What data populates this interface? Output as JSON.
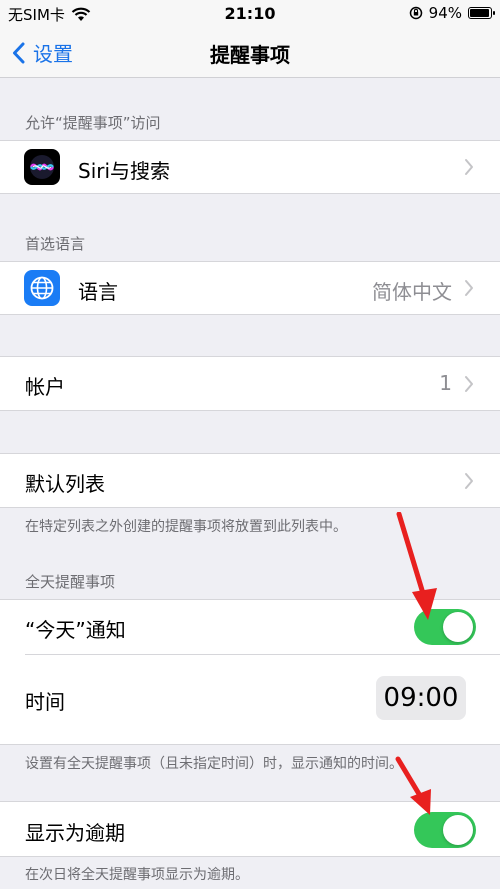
{
  "status_bar": {
    "carrier": "无SIM卡",
    "time": "21:10",
    "battery": "94%",
    "battery_level": 0.94
  },
  "nav": {
    "back_label": "设置",
    "title": "提醒事项"
  },
  "sections": {
    "access_header": "允许“提醒事项”访问",
    "siri_label": "Siri与搜索",
    "language_header": "首选语言",
    "language_label": "语言",
    "language_value": "简体中文",
    "accounts_label": "帐户",
    "accounts_value": "1",
    "default_list_label": "默认列表",
    "default_list_footer": "在特定列表之外创建的提醒事项将放置到此列表中。",
    "allday_header": "全天提醒事项",
    "today_notify_label": "“今天”通知",
    "today_notify_on": true,
    "time_label": "时间",
    "time_value": "09:00",
    "time_footer": "设置有全天提醒事项（且未指定时间）时，显示通知的时间。",
    "overdue_label": "显示为逾期",
    "overdue_on": true,
    "overdue_footer": "在次日将全天提醒事项显示为逾期。"
  },
  "colors": {
    "accent": "#1a73e8",
    "toggle_on": "#34c759",
    "annotation_arrow": "#e8201f"
  },
  "icons": [
    "back-chevron-icon",
    "wifi-icon",
    "orientation-lock-icon",
    "siri-icon",
    "globe-icon",
    "chevron-right-icon"
  ]
}
